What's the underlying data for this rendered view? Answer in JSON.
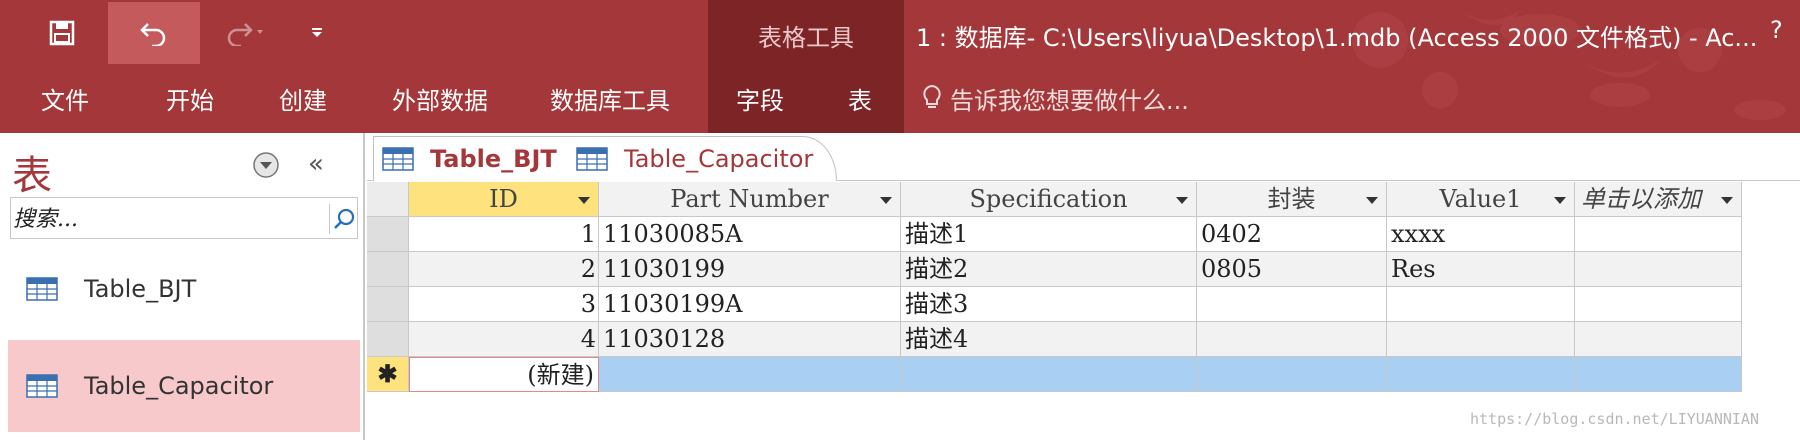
{
  "ribbon": {
    "context_group_title": "表格工具",
    "window_title": "1 : 数据库- C:\\Users\\liyua\\Desktop\\1.mdb (Access 2000 文件格式) - Ac...",
    "help": "?",
    "tabs": [
      {
        "label": "文件"
      },
      {
        "label": "开始"
      },
      {
        "label": "创建"
      },
      {
        "label": "外部数据"
      },
      {
        "label": "数据库工具"
      },
      {
        "label": "字段"
      },
      {
        "label": "表"
      }
    ],
    "tell_me": "告诉我您想要做什么...",
    "accent_color": "#a4373a",
    "context_color": "#7d2427"
  },
  "nav": {
    "title": "表",
    "search_placeholder": "搜索...",
    "items": [
      {
        "label": "Table_BJT",
        "selected": false
      },
      {
        "label": "Table_Capacitor",
        "selected": true
      }
    ]
  },
  "document": {
    "tabs": [
      {
        "label": "Table_BJT",
        "active": true
      },
      {
        "label": "Table_Capacitor",
        "active": false
      }
    ]
  },
  "grid": {
    "columns": [
      "ID",
      "Part Number",
      "Specification",
      "封装",
      "Value1",
      "单击以添加"
    ],
    "rows": [
      [
        "1",
        "11030085A",
        "描述1",
        "0402",
        "xxxx",
        ""
      ],
      [
        "2",
        "11030199",
        "描述2",
        "0805",
        "Res",
        ""
      ],
      [
        "3",
        "11030199A",
        "描述3",
        "",
        "",
        ""
      ],
      [
        "4",
        "11030128",
        "描述4",
        "",
        "",
        ""
      ]
    ],
    "new_row_marker": "✱",
    "new_row_label": "(新建)"
  },
  "watermark": "https://blog.csdn.net/LIYUANNIAN"
}
